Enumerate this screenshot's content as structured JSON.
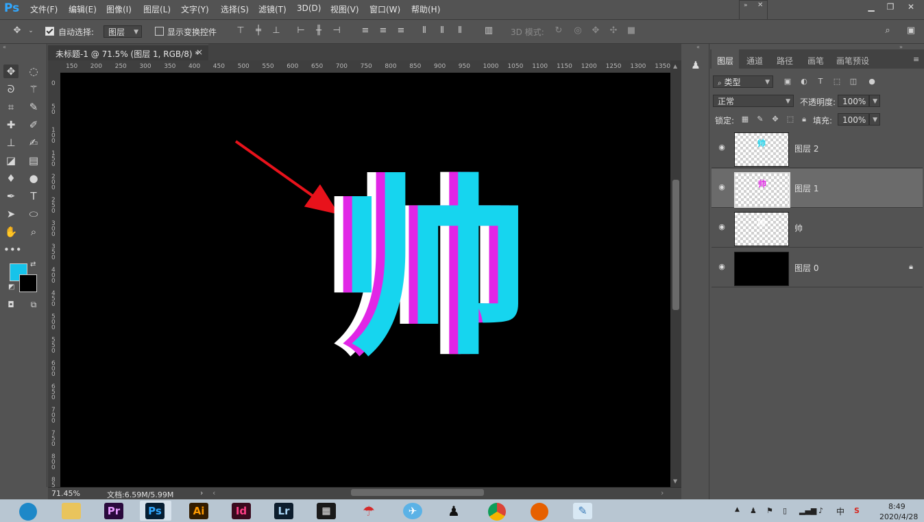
{
  "app": {
    "logo": "Ps"
  },
  "menu": [
    "文件(F)",
    "编辑(E)",
    "图像(I)",
    "图层(L)",
    "文字(Y)",
    "选择(S)",
    "滤镜(T)",
    "3D(D)",
    "视图(V)",
    "窗口(W)",
    "帮助(H)"
  ],
  "options": {
    "auto_select_label": "自动选择:",
    "auto_select_checked": true,
    "target_value": "图层",
    "show_transform_label": "显示变换控件",
    "show_transform_checked": false,
    "mode_3d_label": "3D 模式:"
  },
  "document": {
    "tab_title": "未标题-1 @ 71.5% (图层 1, RGB/8) *",
    "close_glyph": "×",
    "ruler_h": [
      "150",
      "200",
      "250",
      "300",
      "350",
      "400",
      "450",
      "500",
      "550",
      "600",
      "650",
      "700",
      "750",
      "800",
      "850",
      "900",
      "950",
      "1000",
      "1050",
      "1100",
      "1150",
      "1200",
      "1250",
      "1300",
      "1350"
    ],
    "ruler_v": [
      "0",
      "50",
      "100",
      "150",
      "200",
      "250",
      "300",
      "350",
      "400",
      "450",
      "500",
      "550",
      "600",
      "650",
      "700",
      "750",
      "800",
      "850"
    ],
    "canvas_char": "帅",
    "char_colors": {
      "white": "#ffffff",
      "magenta": "#e126e6",
      "cyan": "#16d5ef"
    },
    "arrow_color": "#e8121b"
  },
  "status": {
    "zoom": "71.45%",
    "doc_info": "文档:6.59M/5.99M"
  },
  "colors": {
    "foreground": "#16c3ea",
    "background": "#000000"
  },
  "layers_panel": {
    "tabs": [
      "图层",
      "通道",
      "路径",
      "画笔",
      "画笔预设"
    ],
    "filter_label": "类型",
    "blend_mode": "正常",
    "opacity_label": "不透明度:",
    "opacity_value": "100%",
    "lock_label": "锁定:",
    "fill_label": "填充:",
    "fill_value": "100%",
    "layers": [
      {
        "name": "图层 2",
        "thumb": "cyan",
        "selected": false,
        "locked": false
      },
      {
        "name": "图层 1",
        "thumb": "magenta",
        "selected": true,
        "locked": false
      },
      {
        "name": "帅",
        "thumb": "white",
        "selected": false,
        "locked": false
      },
      {
        "name": "图层 0",
        "thumb": "black",
        "selected": false,
        "locked": true
      }
    ]
  },
  "taskbar": {
    "apps": [
      {
        "name": "browser-app",
        "label": ""
      },
      {
        "name": "file-explorer",
        "label": ""
      },
      {
        "name": "premiere",
        "label": "Pr"
      },
      {
        "name": "photoshop",
        "label": "Ps"
      },
      {
        "name": "illustrator",
        "label": "Ai"
      },
      {
        "name": "indesign",
        "label": "Id"
      },
      {
        "name": "lightroom",
        "label": "Lr"
      },
      {
        "name": "video-editor",
        "label": ""
      },
      {
        "name": "umbrella-app",
        "label": ""
      },
      {
        "name": "bird-app",
        "label": ""
      },
      {
        "name": "qq",
        "label": ""
      },
      {
        "name": "chrome",
        "label": ""
      },
      {
        "name": "firefox",
        "label": ""
      },
      {
        "name": "notepad-app",
        "label": ""
      }
    ],
    "ime": "中",
    "time": "8:49",
    "date": "2020/4/28"
  }
}
